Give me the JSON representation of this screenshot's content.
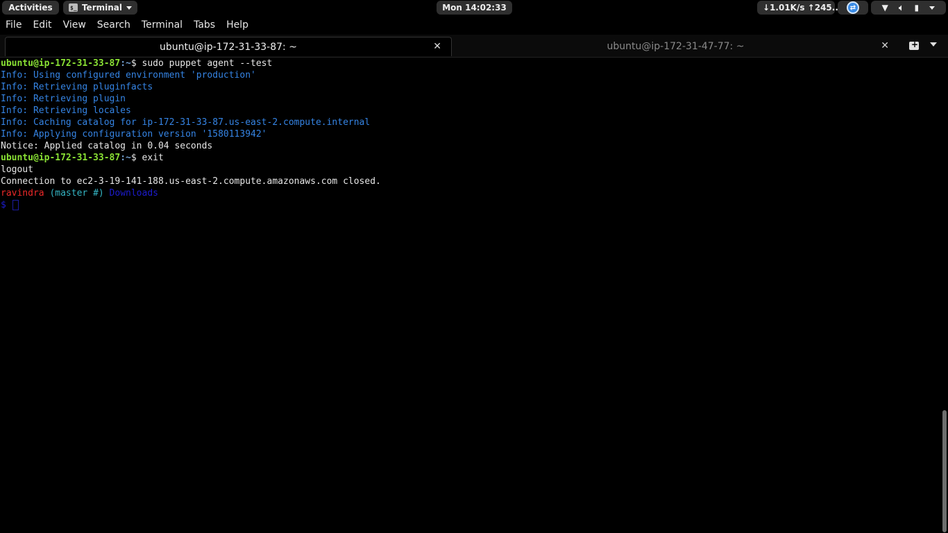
{
  "top_panel": {
    "activities": "Activities",
    "app_name": "Terminal",
    "clock": "Mon 14:02:33",
    "netspeed": "↓1.01K/s ↑245..."
  },
  "menubar": {
    "items": [
      "File",
      "Edit",
      "View",
      "Search",
      "Terminal",
      "Tabs",
      "Help"
    ]
  },
  "tabs": [
    {
      "title": "ubuntu@ip-172-31-33-87: ~",
      "active": true
    },
    {
      "title": "ubuntu@ip-172-31-47-77: ~",
      "active": false
    }
  ],
  "terminal": {
    "prompt_user_host": "ubuntu@ip-172-31-33-87",
    "prompt_path": ":~",
    "prompt_symbol": "$ ",
    "cmd1": "sudo puppet agent --test",
    "info_lines": [
      "Info: Using configured environment 'production'",
      "Info: Retrieving pluginfacts",
      "Info: Retrieving plugin",
      "Info: Retrieving locales",
      "Info: Caching catalog for ip-172-31-33-87.us-east-2.compute.internal",
      "Info: Applying configuration version '1580113942'"
    ],
    "notice": "Notice: Applied catalog in 0.04 seconds",
    "cmd2": "exit",
    "logout": "logout",
    "connection_closed": "Connection to ec2-3-19-141-188.us-east-2.compute.amazonaws.com closed.",
    "local_user": "ravindra",
    "git_branch": " (master #)",
    "local_dir": " Downloads",
    "local_prompt": "$ "
  },
  "colors": {
    "prompt_green": "#8ae234",
    "info_blue": "#3584e4",
    "local_user_red": "#ef2929"
  }
}
